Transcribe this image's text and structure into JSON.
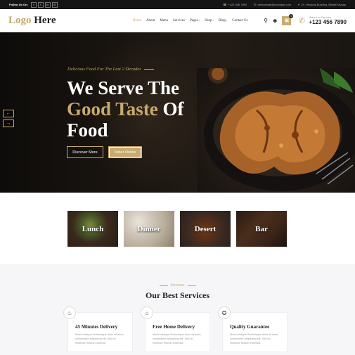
{
  "topbar": {
    "follow_label": "Follow Us On:",
    "social": [
      {
        "icon": "facebook-icon",
        "glyph": "f"
      },
      {
        "icon": "twitter-icon",
        "glyph": "t"
      },
      {
        "icon": "linkedin-icon",
        "glyph": "in"
      },
      {
        "icon": "instagram-icon",
        "glyph": "◎"
      }
    ],
    "phone": "+123 456 7890",
    "email": "demoemail@example.com",
    "address": "23, Hinduraj Bullding, Bhaktt Nivaas"
  },
  "header": {
    "logo_a": "Logo",
    "logo_b": " Here",
    "nav": [
      {
        "label": "Home",
        "active": true,
        "dropdown": false
      },
      {
        "label": "About",
        "active": false,
        "dropdown": false
      },
      {
        "label": "Menu",
        "active": false,
        "dropdown": false
      },
      {
        "label": "Services",
        "active": false,
        "dropdown": false
      },
      {
        "label": "Pages",
        "active": false,
        "dropdown": true
      },
      {
        "label": "Shop",
        "active": false,
        "dropdown": true
      },
      {
        "label": "Blog",
        "active": false,
        "dropdown": true
      },
      {
        "label": "Contact Us",
        "active": false,
        "dropdown": false
      }
    ],
    "cart_count": "0",
    "order_label": "Order it on Cart now",
    "order_phone": "+123 456 7890"
  },
  "hero": {
    "tagline": "Delicious Food For The Last 2 Decades",
    "line1": "We Serve The",
    "line2_gold": "Good Taste",
    "line2_rest": " Of",
    "line3": "Food",
    "btn_discover": "Discover More",
    "btn_order": "Order Online"
  },
  "categories": [
    {
      "label": "Lunch"
    },
    {
      "label": "Dinner"
    },
    {
      "label": "Desert"
    },
    {
      "label": "Bar"
    }
  ],
  "services": {
    "kicker": "Services",
    "title": "Our Best Services",
    "cards": [
      {
        "icon": "chef-hat-icon",
        "glyph": "♨",
        "name": "45 Minutes Delivery",
        "desc": "Morbi tristique Scelerisque dolor sit amet, consectetur adipiscing elit. Sed do eiusmod Teacup euismod."
      },
      {
        "icon": "building-icon",
        "glyph": "⌂",
        "name": "Free Home Delivery",
        "desc": "Morbi tristique Scelerisque dolor sit amet, consectetur adipiscing elit. Sed do eiusmod Teacup euismod."
      },
      {
        "icon": "badge-icon",
        "glyph": "✪",
        "name": "Quality Guarantee",
        "desc": "Morbi tristique Scelerisque dolor sit amet, consectetur adipiscing elit. Sed do eiusmod Teacup euismod."
      }
    ]
  },
  "colors": {
    "accent": "#c8a96e",
    "dark": "#151515",
    "services_bg": "#f6f6f8"
  }
}
